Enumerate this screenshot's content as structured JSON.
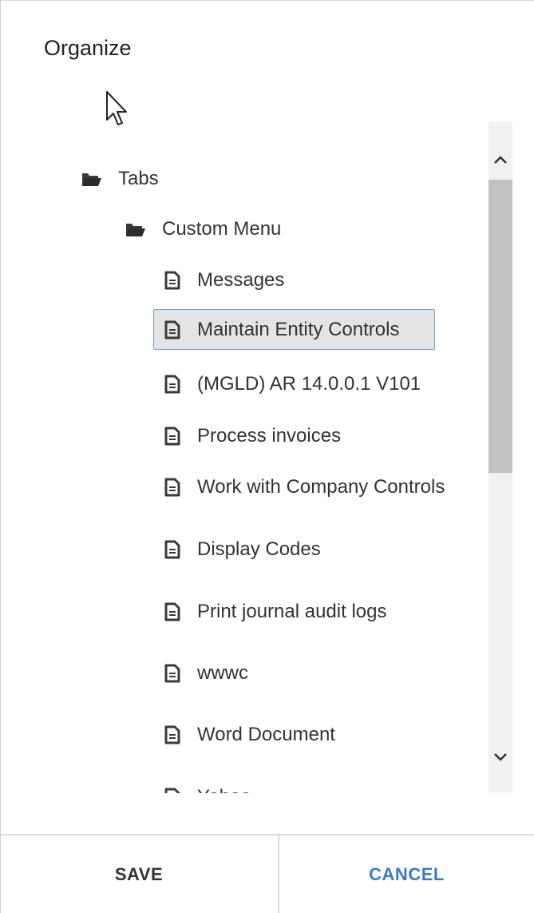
{
  "dialog": {
    "title": "Organize"
  },
  "tree": {
    "root": {
      "label": "Tabs",
      "icon": "folder-open-icon"
    },
    "folder": {
      "label": "Custom Menu",
      "icon": "folder-open-icon"
    },
    "items": [
      {
        "label": "Messages",
        "icon": "document-icon"
      },
      {
        "label": "Maintain Entity Controls",
        "icon": "document-icon",
        "selected": true
      },
      {
        "label": "(MGLD) AR 14.0.0.1 V101",
        "icon": "document-icon"
      },
      {
        "label": "Process invoices",
        "icon": "document-icon"
      },
      {
        "label": "Work with Company Controls",
        "icon": "document-icon"
      },
      {
        "label": "Display Codes",
        "icon": "document-icon"
      },
      {
        "label": "Print journal audit logs",
        "icon": "document-icon"
      },
      {
        "label": "wwwc",
        "icon": "document-icon"
      },
      {
        "label": "Word Document",
        "icon": "document-icon"
      },
      {
        "label": "Yahoo",
        "icon": "document-icon"
      }
    ]
  },
  "footer": {
    "save_label": "SAVE",
    "cancel_label": "CANCEL"
  },
  "colors": {
    "selection_border": "#6fa0cc",
    "selection_fill": "#e4e4e4",
    "cancel_text": "#3b7bc7",
    "icon": "#3a3a3a"
  }
}
